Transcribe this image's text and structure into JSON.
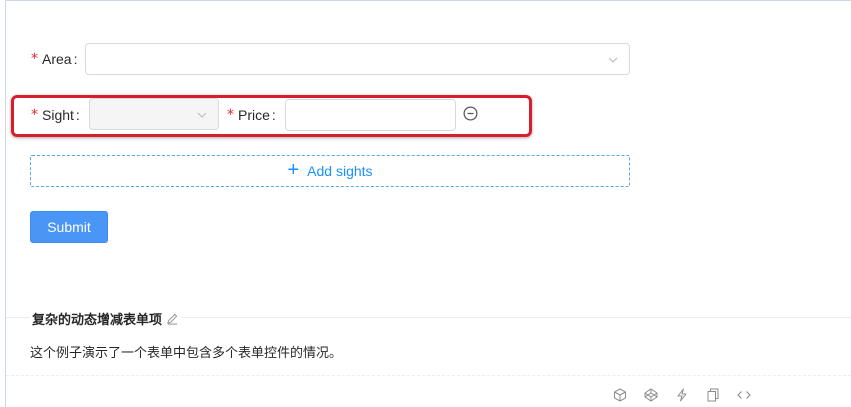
{
  "form": {
    "area": {
      "required_mark": "*",
      "label": "Area",
      "colon": ":",
      "value": ""
    },
    "sight": {
      "required_mark": "*",
      "label": "Sight",
      "colon": ":",
      "value": "",
      "disabled": true
    },
    "price": {
      "required_mark": "*",
      "label": "Price",
      "colon": ":",
      "value": ""
    },
    "add_button": {
      "icon": "+",
      "label": "Add sights"
    },
    "submit_button": {
      "label": "Submit"
    }
  },
  "demo": {
    "title": "复杂的动态增减表单项",
    "description": "这个例子演示了一个表单中包含多个表单控件的情况。"
  },
  "icons": {
    "select_arrow": "chevron-down-icon",
    "remove": "minus-circle-icon",
    "edit": "edit-icon",
    "actions": [
      "codesandbox-icon",
      "codepen-icon",
      "riddle-icon",
      "copy-icon",
      "code-icon"
    ]
  },
  "colors": {
    "primary": "#1890ff",
    "required": "#f5222d",
    "highlight": "#d81e2c"
  }
}
